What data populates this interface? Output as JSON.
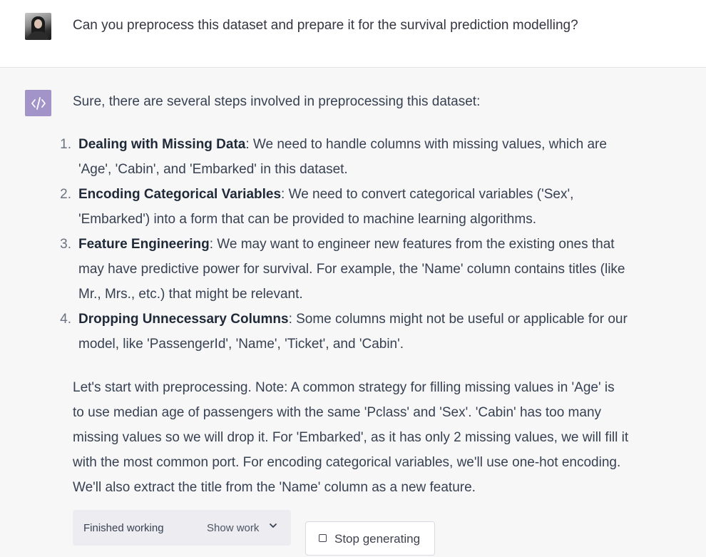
{
  "user_message": {
    "avatar_icon": "user-avatar-photo",
    "text": "Can you preprocess this dataset and prepare it for the survival prediction modelling?"
  },
  "assistant_message": {
    "avatar_icon": "code-icon",
    "avatar_color": "#a293c9",
    "intro": "Sure, there are several steps involved in preprocessing this dataset:",
    "steps": [
      {
        "number": "1.",
        "title": "Dealing with Missing Data",
        "line1": ": We need to handle columns with missing values, which are",
        "line2": "'Age', 'Cabin', and 'Embarked' in this dataset."
      },
      {
        "number": "2.",
        "title": "Encoding Categorical Variables",
        "line1": ": We need to convert categorical variables ('Sex',",
        "line2": "'Embarked') into a form that can be provided to machine learning algorithms."
      },
      {
        "number": "3.",
        "title": "Feature Engineering",
        "line1": ": We may want to engineer new features from the existing ones that",
        "line2": "may have predictive power for survival. For example, the 'Name' column contains titles (like",
        "line3": "Mr., Mrs., etc.) that might be relevant."
      },
      {
        "number": "4.",
        "title": "Dropping Unnecessary Columns",
        "line1": ": Some columns might not be useful or applicable for our",
        "line2": "model, like 'PassengerId', 'Name', 'Ticket', and 'Cabin'."
      }
    ],
    "paragraph_lines": [
      "Let's start with preprocessing. Note: A common strategy for filling missing values in 'Age' is",
      "to use median age of passengers with the same 'Pclass' and 'Sex'. 'Cabin' has too many",
      "missing values so we will drop it. For 'Embarked', as it has only 2 missing values, we will fill it",
      "with the most common port. For encoding categorical variables, we'll use one-hot encoding.",
      "We'll also extract the title from the 'Name' column as a new feature."
    ],
    "working": {
      "status": "Finished working",
      "toggle_label": "Show work",
      "toggle_icon": "chevron-down-icon"
    }
  },
  "stop_button": {
    "icon": "stop-square-icon",
    "label": "Stop generating"
  }
}
